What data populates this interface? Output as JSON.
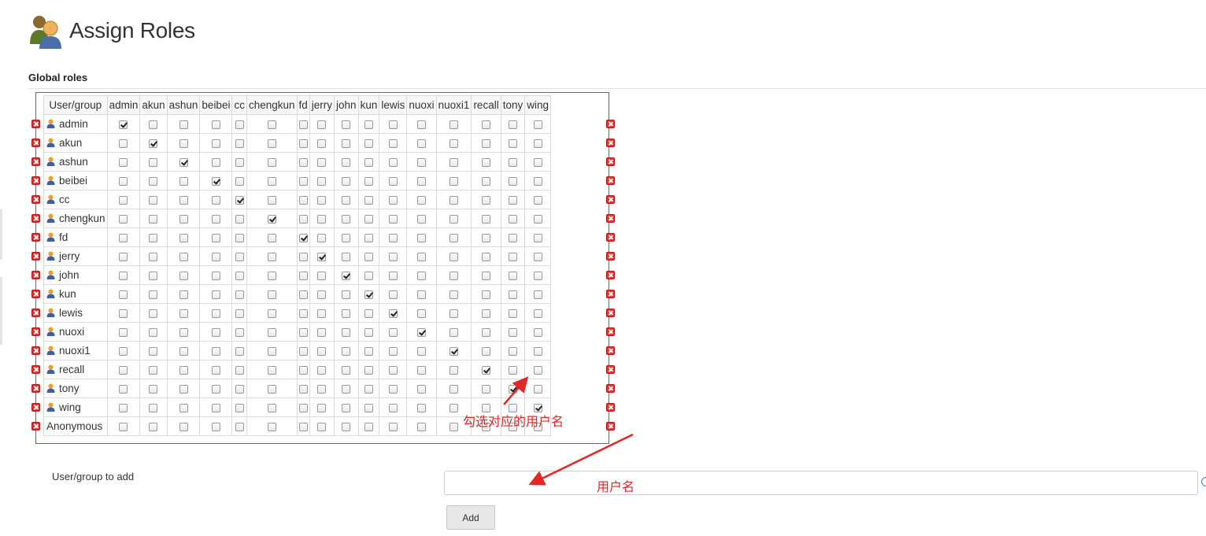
{
  "page": {
    "title": "Assign Roles"
  },
  "global_roles": {
    "section_title": "Global roles",
    "corner_header": "User/group",
    "role_columns": [
      "admin",
      "akun",
      "ashun",
      "beibei",
      "cc",
      "chengkun",
      "fd",
      "jerry",
      "john",
      "kun",
      "lewis",
      "nuoxi",
      "nuoxi1",
      "recall",
      "tony",
      "wing"
    ],
    "rows": [
      {
        "name": "admin",
        "is_user": true,
        "checked": [
          "admin"
        ]
      },
      {
        "name": "akun",
        "is_user": true,
        "checked": [
          "akun"
        ]
      },
      {
        "name": "ashun",
        "is_user": true,
        "checked": [
          "ashun"
        ]
      },
      {
        "name": "beibei",
        "is_user": true,
        "checked": [
          "beibei"
        ]
      },
      {
        "name": "cc",
        "is_user": true,
        "checked": [
          "cc"
        ]
      },
      {
        "name": "chengkun",
        "is_user": true,
        "checked": [
          "chengkun"
        ]
      },
      {
        "name": "fd",
        "is_user": true,
        "checked": [
          "fd"
        ]
      },
      {
        "name": "jerry",
        "is_user": true,
        "checked": [
          "jerry"
        ]
      },
      {
        "name": "john",
        "is_user": true,
        "checked": [
          "john"
        ]
      },
      {
        "name": "kun",
        "is_user": true,
        "checked": [
          "kun"
        ]
      },
      {
        "name": "lewis",
        "is_user": true,
        "checked": [
          "lewis"
        ]
      },
      {
        "name": "nuoxi",
        "is_user": true,
        "checked": [
          "nuoxi"
        ]
      },
      {
        "name": "nuoxi1",
        "is_user": true,
        "checked": [
          "nuoxi1"
        ]
      },
      {
        "name": "recall",
        "is_user": true,
        "checked": [
          "recall"
        ]
      },
      {
        "name": "tony",
        "is_user": true,
        "checked": [
          "tony"
        ]
      },
      {
        "name": "wing",
        "is_user": true,
        "checked": [
          "wing"
        ]
      },
      {
        "name": "Anonymous",
        "is_user": false,
        "checked": []
      }
    ]
  },
  "add_form": {
    "label": "User/group to add",
    "input_value": "",
    "button_label": "Add"
  },
  "annotations": {
    "check_hint": "勾选对应的用户名",
    "username_hint": "用户名"
  },
  "icons": {
    "header": "user-group-icon",
    "row_user": "user-icon",
    "delete": "delete-icon",
    "help": "help-icon"
  },
  "colors": {
    "annotation": "#e32626",
    "delete_icon": "#e0302e"
  }
}
